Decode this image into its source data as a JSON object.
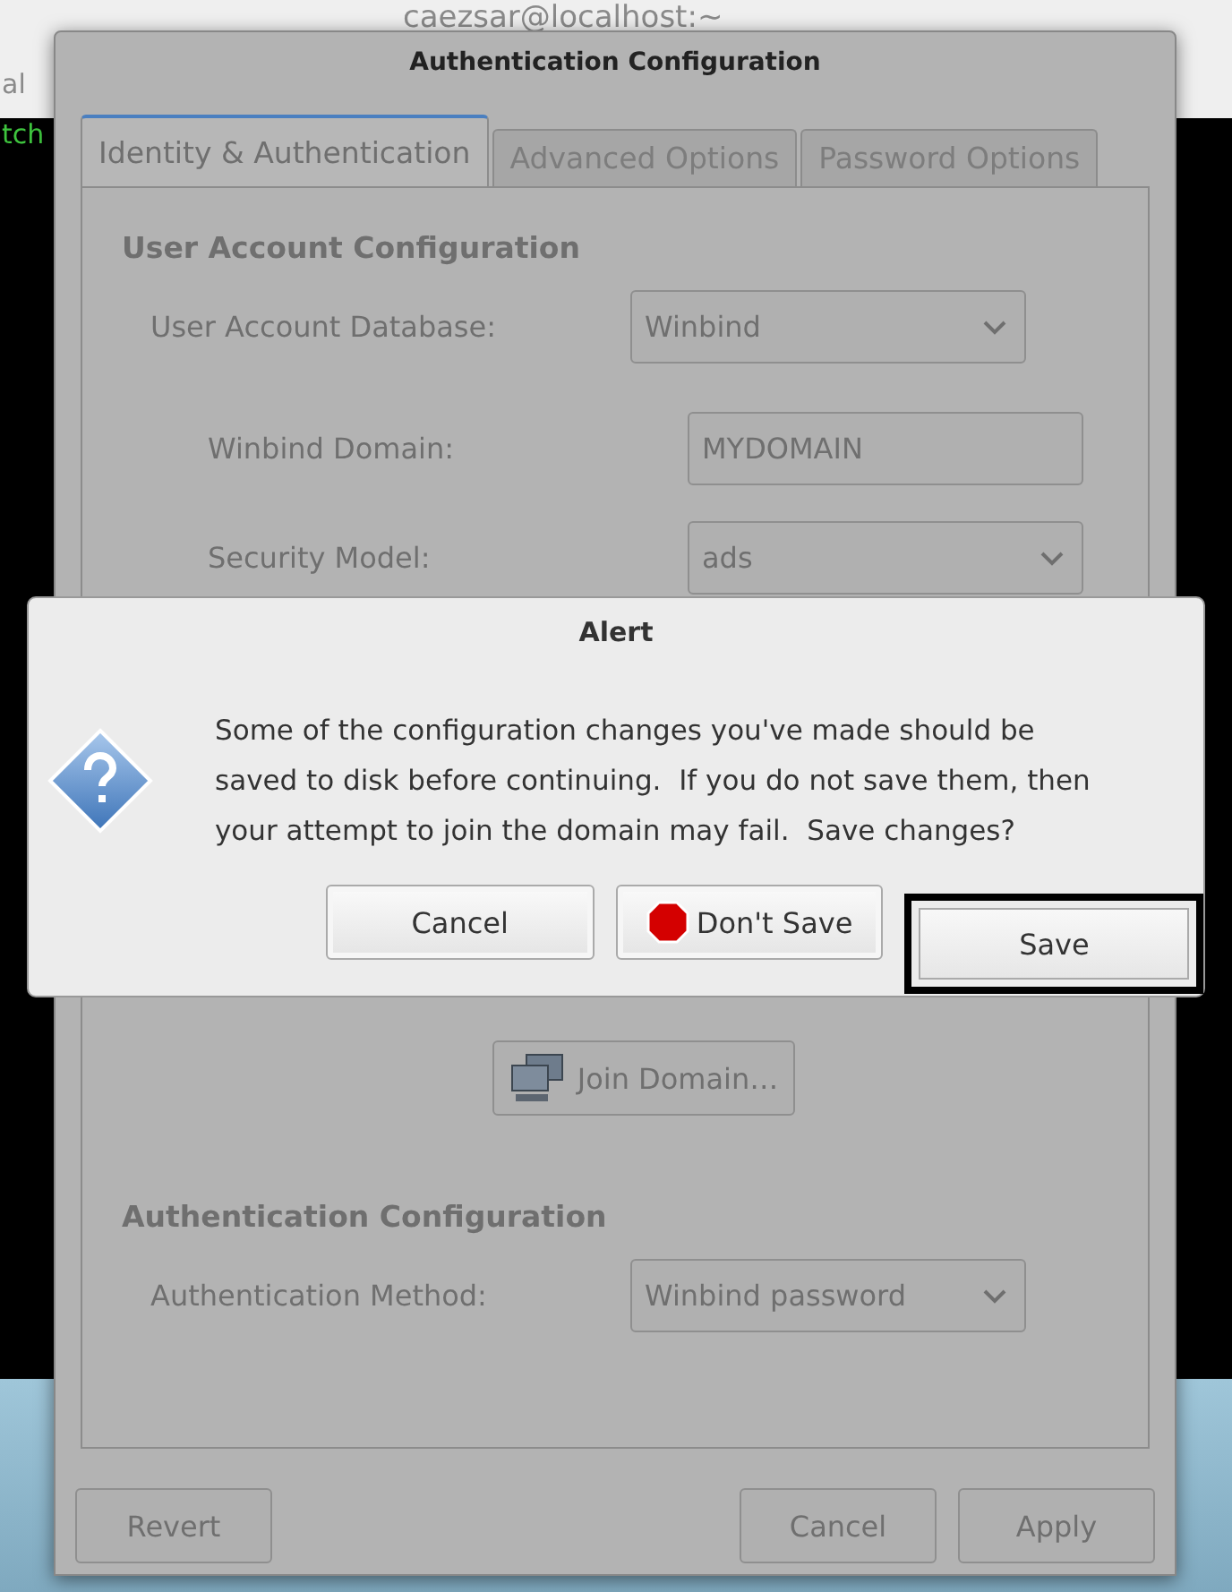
{
  "terminal": {
    "title": "caezsar@localhost:~",
    "left_label": "al",
    "prompt_fragment": "tch"
  },
  "dialog": {
    "title": "Authentication Configuration",
    "disabled": true,
    "tabs": [
      {
        "label": "Identity & Authentication",
        "selected": true
      },
      {
        "label": "Advanced Options",
        "selected": false
      },
      {
        "label": "Password Options",
        "selected": false
      }
    ],
    "sections": [
      {
        "heading": "User Account Configuration",
        "fields": [
          {
            "kind": "combo",
            "label": "User Account Database:",
            "value": "Winbind",
            "children": [
              {
                "kind": "text",
                "label": "Winbind Domain:",
                "value": "MYDOMAIN"
              },
              {
                "kind": "combo",
                "label": "Security Model:",
                "value": "ads"
              }
            ]
          }
        ]
      },
      {
        "heading": "Authentication Configuration",
        "fields": [
          {
            "kind": "combo",
            "label": "Authentication Method:",
            "value": "Winbind password"
          }
        ]
      }
    ],
    "join_button": {
      "label": "Join Domain…"
    },
    "buttons": [
      {
        "label": "Revert"
      },
      {
        "label": "Cancel"
      },
      {
        "label": "Apply"
      }
    ]
  },
  "alert": {
    "title": "Alert",
    "message": "Some of the configuration changes you've made should be saved to disk before continuing.  If you do not save them, then your attempt to join the domain may fail.  Save changes?",
    "buttons": [
      {
        "label": "Cancel",
        "kind": "plain",
        "highlighted": false
      },
      {
        "label": "Don't Save",
        "kind": "stop",
        "highlighted": false
      },
      {
        "label": "Save",
        "kind": "plain",
        "highlighted": true
      }
    ]
  }
}
